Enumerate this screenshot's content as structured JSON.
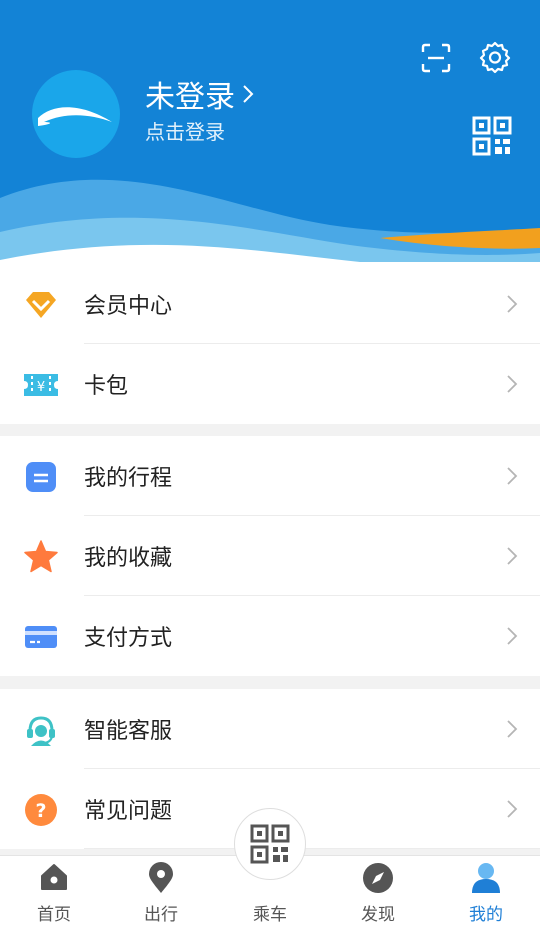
{
  "header": {
    "user_name": "未登录",
    "login_hint": "点击登录",
    "icons": [
      "scan-icon",
      "settings-icon",
      "qr-code-icon"
    ]
  },
  "menu_group_1": [
    {
      "label": "会员中心",
      "icon": "diamond-icon",
      "color": "#f5a623"
    },
    {
      "label": "卡包",
      "icon": "ticket-icon",
      "color": "#3bbce4"
    }
  ],
  "menu_group_2": [
    {
      "label": "我的行程",
      "icon": "itinerary-icon",
      "color": "#4f8ef7"
    },
    {
      "label": "我的收藏",
      "icon": "star-icon",
      "color": "#ff7a3d"
    },
    {
      "label": "支付方式",
      "icon": "card-icon",
      "color": "#4f8ef7"
    }
  ],
  "menu_group_3": [
    {
      "label": "智能客服",
      "icon": "headset-icon",
      "color": "#3ec2c6"
    },
    {
      "label": "常见问题",
      "icon": "question-icon",
      "color": "#ff8a3d"
    }
  ],
  "tabbar": {
    "tabs": [
      {
        "label": "首页",
        "icon": "home-icon"
      },
      {
        "label": "出行",
        "icon": "location-pin-icon"
      },
      {
        "label": "乘车",
        "icon": "qr-code-icon"
      },
      {
        "label": "发现",
        "icon": "compass-icon"
      },
      {
        "label": "我的",
        "icon": "profile-icon",
        "active": true
      }
    ]
  },
  "colors": {
    "primary": "#1383d6",
    "accent": "#f5a623",
    "background": "#f2f2f2"
  }
}
